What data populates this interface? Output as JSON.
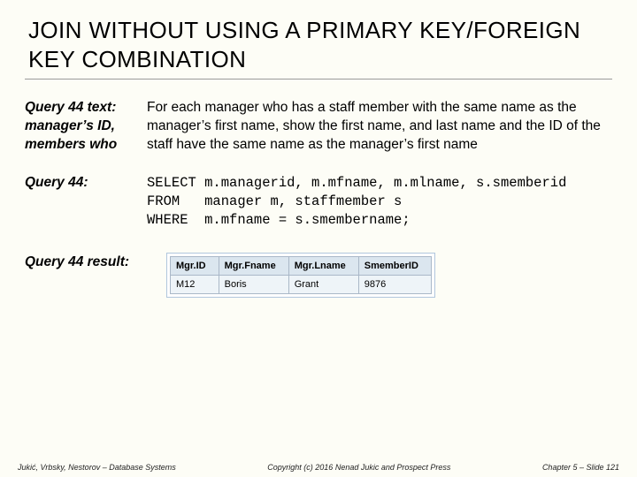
{
  "title": "JOIN WITHOUT USING A PRIMARY KEY/FOREIGN KEY COMBINATION",
  "q_text_label": "Query 44 text:\nmanager’s ID,\nmembers who",
  "q_text_body": "For each manager who has a staff member with the same name as the manager’s first name, show the first name, and last name and the ID of the staff have the same name as the manager’s first name",
  "q_label": "Query 44:",
  "sql": "SELECT m.managerid, m.mfname, m.mlname, s.smemberid\nFROM   manager m, staffmember s\nWHERE  m.mfname = s.smembername;",
  "result_label": "Query 44 result:",
  "result": {
    "headers": [
      "Mgr.ID",
      "Mgr.Fname",
      "Mgr.Lname",
      "SmemberID"
    ],
    "rows": [
      [
        "M12",
        "Boris",
        "Grant",
        "9876"
      ]
    ]
  },
  "footer_left": "Jukić, Vrbsky, Nestorov – Database Systems",
  "footer_center": "Copyright (c) 2016 Nenad Jukic and Prospect Press",
  "footer_right": "Chapter 5 – Slide 121"
}
